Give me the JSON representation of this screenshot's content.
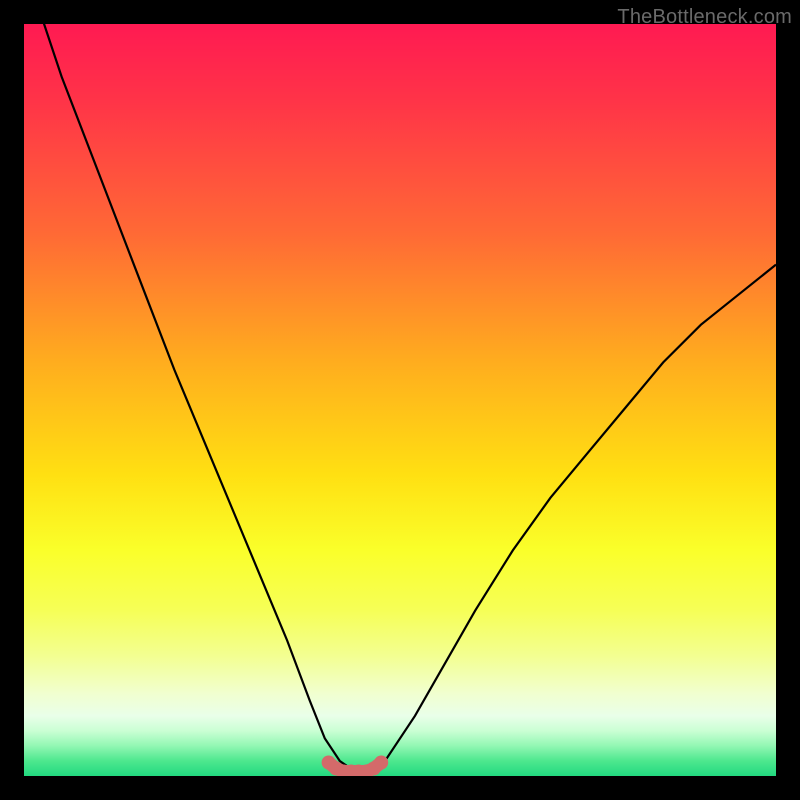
{
  "watermark": {
    "text": "TheBottleneck.com"
  },
  "colors": {
    "background": "#000000",
    "curve": "#000000",
    "marker": "#d46a6a",
    "gradient_top": "#ff1a52",
    "gradient_bottom": "#22d980"
  },
  "chart_data": {
    "type": "line",
    "title": "",
    "xlabel": "",
    "ylabel": "",
    "xlim": [
      0,
      100
    ],
    "ylim": [
      0,
      100
    ],
    "grid": false,
    "series": [
      {
        "name": "bottleneck-curve",
        "x": [
          0,
          5,
          10,
          15,
          20,
          25,
          30,
          35,
          38,
          40,
          42,
          44,
          46,
          48,
          52,
          56,
          60,
          65,
          70,
          75,
          80,
          85,
          90,
          95,
          100
        ],
        "y": [
          108,
          93,
          80,
          67,
          54,
          42,
          30,
          18,
          10,
          5,
          2,
          0.6,
          0.6,
          2,
          8,
          15,
          22,
          30,
          37,
          43,
          49,
          55,
          60,
          64,
          68
        ]
      }
    ],
    "markers": {
      "name": "bottleneck-flat-markers",
      "x": [
        40.5,
        41.5,
        42.5,
        43.5,
        44.5,
        45.5,
        46.5,
        47.5
      ],
      "y": [
        1.8,
        1.0,
        0.6,
        0.6,
        0.6,
        0.6,
        1.0,
        1.8
      ]
    }
  }
}
